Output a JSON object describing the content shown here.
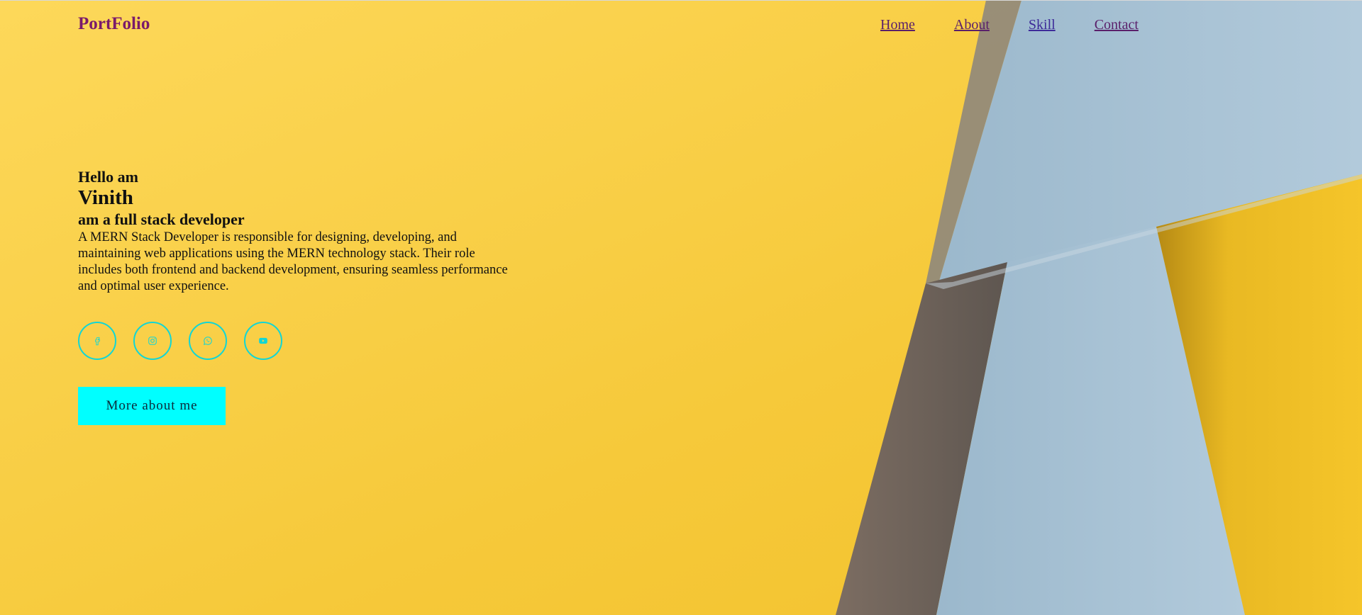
{
  "header": {
    "logo": "PortFolio",
    "nav": [
      {
        "label": "Home"
      },
      {
        "label": "About"
      },
      {
        "label": "Skill"
      },
      {
        "label": "Contact"
      }
    ]
  },
  "hero": {
    "greeting": "Hello am",
    "name": "Vinith",
    "role": "am a full stack developer",
    "description": "A MERN Stack Developer is responsible for designing, developing, and maintaining web applications using the MERN technology stack. Their role includes both frontend and backend development, ensuring seamless performance and optimal user experience.",
    "socials": [
      {
        "icon": "facebook-icon"
      },
      {
        "icon": "instagram-icon"
      },
      {
        "icon": "whatsapp-icon"
      },
      {
        "icon": "youtube-icon"
      }
    ],
    "cta_label": "More about me"
  },
  "colors": {
    "background_yellow": "#fbd24c",
    "accent_cyan": "#00ffff",
    "logo_purple": "#7a1a6b",
    "panel_blue": "#a7c3d6"
  }
}
